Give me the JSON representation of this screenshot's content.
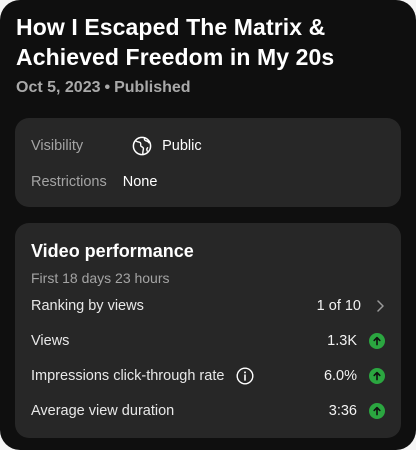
{
  "video": {
    "title": "How I Escaped The Matrix & Achieved Freedom in My 20s",
    "date": "Oct 5, 2023",
    "separator": "•",
    "status": "Published"
  },
  "details": {
    "visibility_label": "Visibility",
    "visibility_icon": "globe-icon",
    "visibility_value": "Public",
    "restrictions_label": "Restrictions",
    "restrictions_value": "None"
  },
  "performance": {
    "title": "Video performance",
    "subtitle": "First 18 days 23 hours",
    "ranking_label": "Ranking by views",
    "ranking_value": "1 of 10",
    "ranking_icon": "chevron-right-icon",
    "metrics": [
      {
        "label": "Views",
        "value": "1.3K",
        "trend": "up"
      },
      {
        "label": "Impressions click-through rate",
        "value": "6.0%",
        "trend": "up",
        "info_icon": "info-icon"
      },
      {
        "label": "Average view duration",
        "value": "3:36",
        "trend": "up"
      }
    ]
  },
  "colors": {
    "background": "#0f0f0f",
    "card": "#272727",
    "muted_text": "#a4a4a4",
    "trend_up": "#2ba640"
  }
}
